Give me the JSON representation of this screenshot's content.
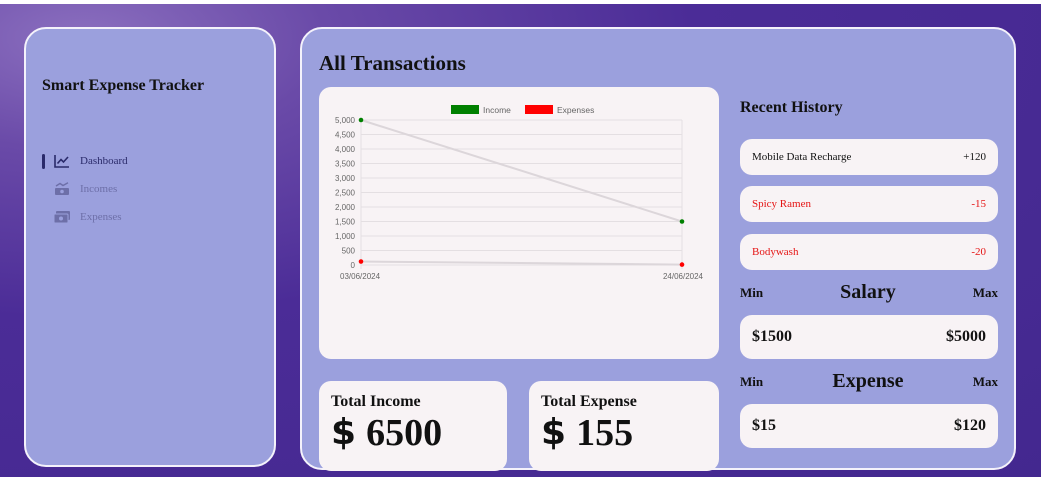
{
  "app": {
    "title": "Smart Expense Tracker"
  },
  "nav": [
    {
      "label": "Dashboard",
      "icon": "chart-line-icon",
      "active": true
    },
    {
      "label": "Incomes",
      "icon": "money-trend-icon",
      "active": false
    },
    {
      "label": "Expenses",
      "icon": "money-bill-icon",
      "active": false
    }
  ],
  "main": {
    "title": "All Transactions"
  },
  "chart_data": {
    "type": "line",
    "x": [
      "03/06/2024",
      "24/06/2024"
    ],
    "series": [
      {
        "name": "Income",
        "values": [
          5000,
          1500
        ],
        "color": "#008000"
      },
      {
        "name": "Expenses",
        "values": [
          120,
          15
        ],
        "color": "#ff0000"
      }
    ],
    "ylim": [
      0,
      5000
    ],
    "yticks": [
      "5,000",
      "4,500",
      "4,000",
      "3,500",
      "3,000",
      "2,500",
      "2,000",
      "1,500",
      "1,000",
      "500",
      "0"
    ],
    "grid": true,
    "legend": "top-center"
  },
  "totals": {
    "income_label": "Total Income",
    "income_symbol": "$",
    "income_value": "6500",
    "expense_label": "Total Expense",
    "expense_symbol": "$",
    "expense_value": "155"
  },
  "history": {
    "title": "Recent History",
    "items": [
      {
        "name": "Mobile Data Recharge",
        "amount": "+120",
        "type": "income"
      },
      {
        "name": "Spicy Ramen",
        "amount": "-15",
        "type": "expense"
      },
      {
        "name": "Bodywash",
        "amount": "-20",
        "type": "expense"
      }
    ]
  },
  "salary": {
    "title": "Salary",
    "min_label": "Min",
    "max_label": "Max",
    "min": "$1500",
    "max": "$5000"
  },
  "expense_range": {
    "title": "Expense",
    "min_label": "Min",
    "max_label": "Max",
    "min": "$15",
    "max": "$120"
  }
}
